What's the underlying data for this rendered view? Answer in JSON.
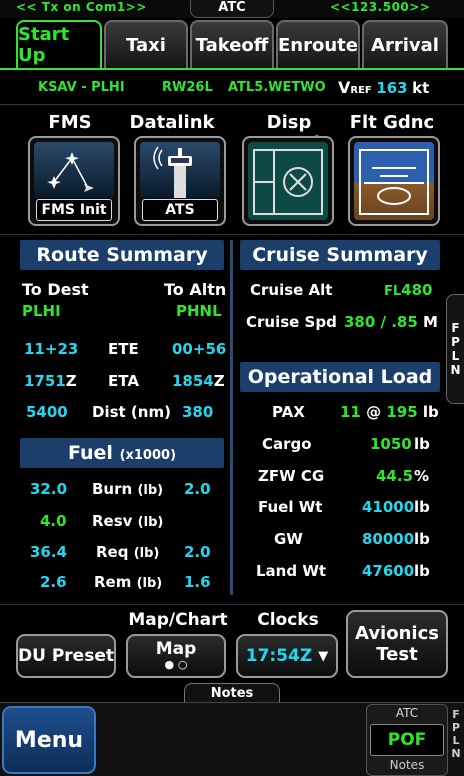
{
  "topbar": {
    "left_status": "<< Tx on Com1>>",
    "center_title": "ATC",
    "right_freq": "<<123.500>>"
  },
  "tabs": [
    {
      "label": "Start Up",
      "active": true
    },
    {
      "label": "Taxi",
      "active": false
    },
    {
      "label": "Takeoff",
      "active": false
    },
    {
      "label": "Enroute",
      "active": false
    },
    {
      "label": "Arrival",
      "active": false
    }
  ],
  "flight_plan": {
    "route": "KSAV - PLHI",
    "runway": "RW26L",
    "departure": "ATL5.WETWO",
    "vref_label": "V",
    "vref_sub": "REF",
    "vref_value": "163",
    "vref_unit": "kt"
  },
  "systems": [
    {
      "label": "FMS",
      "caption": "FMS Init",
      "icon": "fms-icon"
    },
    {
      "label": "Datalink",
      "caption": "ATS",
      "icon": "tower-icon"
    },
    {
      "label": "Disp Contrl",
      "caption": "",
      "icon": "display-control-icon"
    },
    {
      "label": "Flt Gdnc",
      "caption": "",
      "icon": "flight-guidance-icon"
    }
  ],
  "route_summary": {
    "title": "Route Summary",
    "to_dest_label": "To Dest",
    "to_dest_value": "PLHI",
    "to_altn_label": "To Altn",
    "to_altn_value": "PHNL",
    "rows": [
      {
        "left": "11+23",
        "label": "ETE",
        "right": "00+56"
      },
      {
        "left": "1751",
        "left_suffix": "Z",
        "label": "ETA",
        "right": "1854",
        "right_suffix": "Z"
      },
      {
        "left": "5400",
        "label": "Dist (nm)",
        "right": "380"
      }
    ]
  },
  "fuel": {
    "title": "Fuel",
    "title_unit": "(x1000)",
    "rows": [
      {
        "left": "32.0",
        "label": "Burn",
        "unit": "(lb)",
        "right": "2.0",
        "left_color": "cyan"
      },
      {
        "left": "4.0",
        "label": "Resv",
        "unit": "(lb)",
        "right": "",
        "left_color": "green"
      },
      {
        "left": "36.4",
        "label": "Req",
        "unit": "(lb)",
        "right": "2.0",
        "left_color": "cyan"
      },
      {
        "left": "2.6",
        "label": "Rem",
        "unit": "(lb)",
        "right": "1.6",
        "left_color": "cyan"
      }
    ]
  },
  "cruise_summary": {
    "title": "Cruise Summary",
    "alt_label": "Cruise Alt",
    "alt_prefix": "FL",
    "alt_value": "480",
    "spd_label": "Cruise Spd",
    "spd_value": "380 / .85",
    "spd_unit": "M"
  },
  "operational_load": {
    "title": "Operational Load",
    "pax_label": "PAX",
    "pax_count": "11",
    "pax_at": "@",
    "pax_weight": "195",
    "pax_unit": "lb",
    "rows": [
      {
        "label": "Cargo",
        "value": "1050",
        "unit": "lb",
        "color": "green"
      },
      {
        "label": "ZFW CG",
        "value": "44.5",
        "unit": "%",
        "color": "green"
      },
      {
        "label": "Fuel Wt",
        "value": "41000",
        "unit": "lb",
        "color": "cyan"
      },
      {
        "label": "GW",
        "value": "80000",
        "unit": "lb",
        "color": "cyan"
      },
      {
        "label": "Land Wt",
        "value": "47600",
        "unit": "lb",
        "color": "cyan"
      }
    ]
  },
  "bottom": {
    "du_preset": "DU Preset",
    "map_chart_caption": "Map/Chart",
    "map_label": "Map",
    "clocks_caption": "Clocks",
    "clock_value": "17:54Z",
    "avionics_test_line1": "Avionics",
    "avionics_test_line2": "Test",
    "notes_tab": "Notes",
    "menu": "Menu",
    "atc_title": "ATC",
    "atc_value": "POF",
    "atc_notes": "Notes"
  },
  "side_tab": {
    "letters": [
      "F",
      "P",
      "L",
      "N"
    ]
  },
  "colors": {
    "green": "#2ee62e",
    "cyan": "#22d8f0",
    "section_header": "#1b3f6a",
    "menu_blue": "#1d4f8e"
  }
}
